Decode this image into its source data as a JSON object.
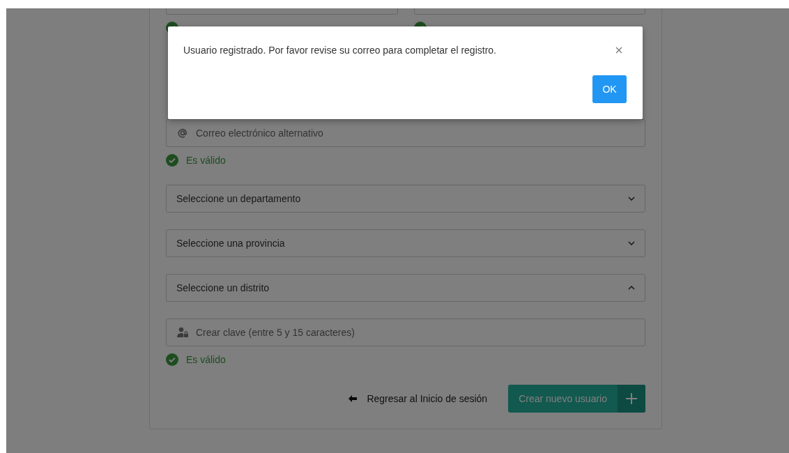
{
  "form": {
    "fields": [
      {
        "kind": "email",
        "placeholder": "Correo electrónico alternativo",
        "status": "Es válido"
      },
      {
        "kind": "select",
        "placeholder": "Seleccione un departamento",
        "expanded": false
      },
      {
        "kind": "select",
        "placeholder": "Seleccione una provincia",
        "expanded": false
      },
      {
        "kind": "select",
        "placeholder": "Seleccione un distrito",
        "expanded": true
      },
      {
        "kind": "password",
        "placeholder": "Crear clave (entre 5 y 15 caracteres)",
        "status": "Es válido"
      }
    ],
    "back_link": "Regresar al Inicio de sesión",
    "submit_button": "Crear nuevo usuario"
  },
  "dialog": {
    "message": "Usuario registrado. Por favor revise su correo para completar el registro.",
    "button": "OK"
  }
}
